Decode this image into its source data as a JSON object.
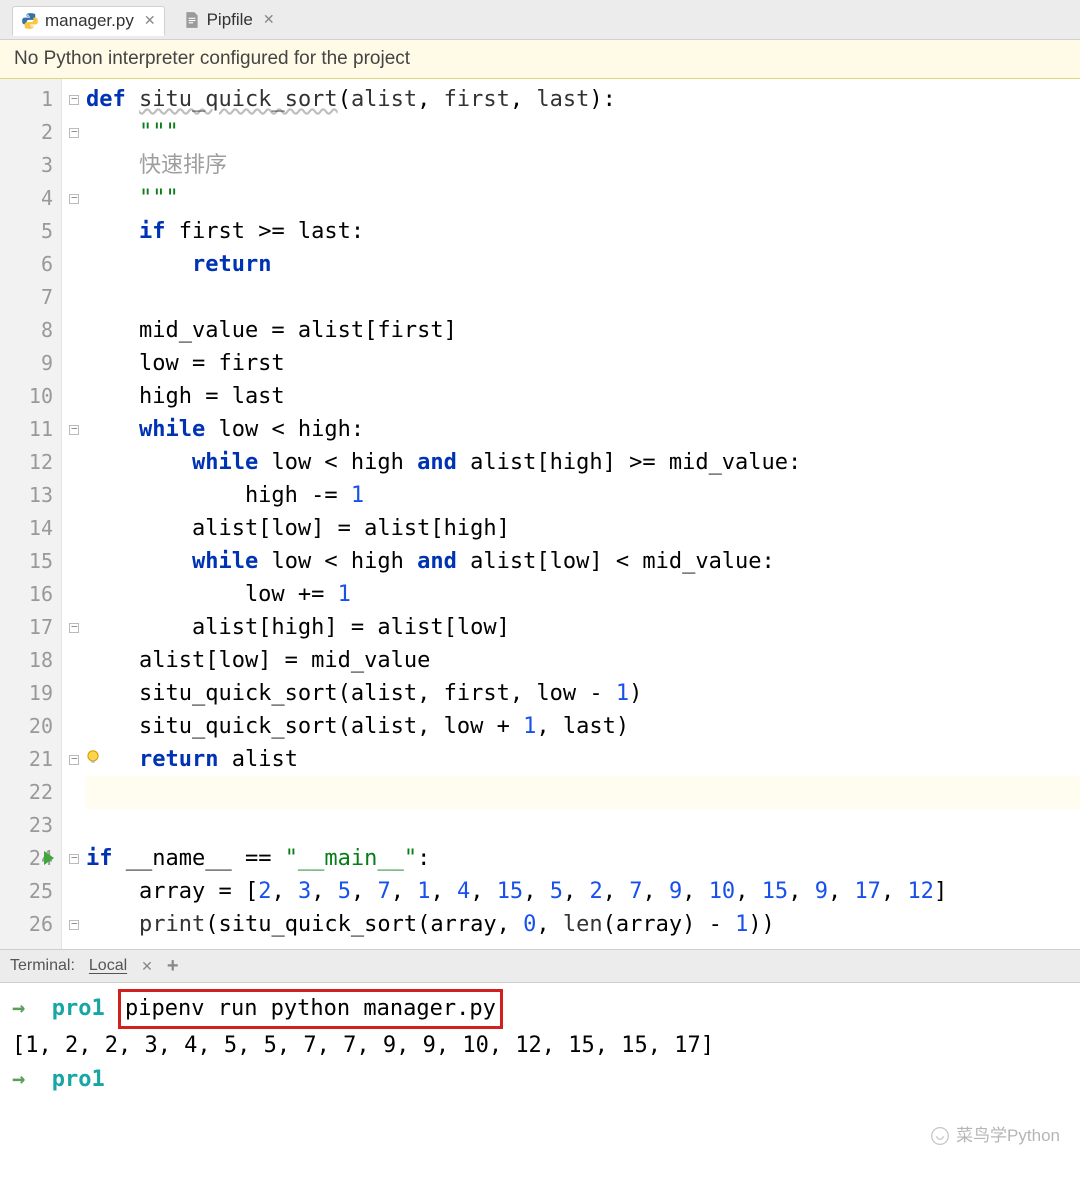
{
  "tabs": [
    {
      "label": "manager.py",
      "icon": "python-file-icon",
      "active": true
    },
    {
      "label": "Pipfile",
      "icon": "text-file-icon",
      "active": false
    }
  ],
  "warning": "No Python interpreter configured for the project",
  "code_lines": [
    {
      "n": 1,
      "fold": "start",
      "html": "<span class='kw'>def</span> <span class='fn wavy'>situ_quick_sort</span>(<span class='pv'>alist</span>, <span class='pv'>first</span>, <span class='pv'>last</span>):"
    },
    {
      "n": 2,
      "fold": "start",
      "html": "    <span class='str'>\"\"\"</span>"
    },
    {
      "n": 3,
      "html": "    <span class='com'>快速排序</span>"
    },
    {
      "n": 4,
      "fold": "end",
      "html": "    <span class='str'>\"\"\"</span>"
    },
    {
      "n": 5,
      "html": "    <span class='kw'>if</span> first &gt;= last:"
    },
    {
      "n": 6,
      "html": "        <span class='kw'>return</span>"
    },
    {
      "n": 7,
      "html": ""
    },
    {
      "n": 8,
      "html": "    mid_value = alist[first]"
    },
    {
      "n": 9,
      "html": "    low = first"
    },
    {
      "n": 10,
      "html": "    high = last"
    },
    {
      "n": 11,
      "fold": "start",
      "html": "    <span class='kw'>while</span> low &lt; high:"
    },
    {
      "n": 12,
      "html": "        <span class='kw'>while</span> low &lt; high <span class='kw'>and</span> alist[high] &gt;= mid_value:"
    },
    {
      "n": 13,
      "html": "            high -= <span class='num'>1</span>"
    },
    {
      "n": 14,
      "html": "        alist[low] = alist[high]"
    },
    {
      "n": 15,
      "html": "        <span class='kw'>while</span> low &lt; high <span class='kw'>and</span> alist[low] &lt; mid_value:"
    },
    {
      "n": 16,
      "html": "            low += <span class='num'>1</span>"
    },
    {
      "n": 17,
      "fold": "end",
      "html": "        alist[high] = alist[low]"
    },
    {
      "n": 18,
      "html": "    alist[low] = mid_value"
    },
    {
      "n": 19,
      "html": "    situ_quick_sort(alist, first, low - <span class='num'>1</span>)"
    },
    {
      "n": 20,
      "html": "    situ_quick_sort(alist, low + <span class='num'>1</span>, last)"
    },
    {
      "n": 21,
      "fold": "end",
      "bulb": true,
      "html": "    <span class='kw'>return</span> alist"
    },
    {
      "n": 22,
      "hl": true,
      "html": ""
    },
    {
      "n": 23,
      "html": ""
    },
    {
      "n": 24,
      "run": true,
      "fold": "start",
      "html": "<span class='kw'>if</span> __name__ == <span class='str'>\"__main__\"</span>:"
    },
    {
      "n": 25,
      "html": "    array = [<span class='num'>2</span>, <span class='num'>3</span>, <span class='num'>5</span>, <span class='num'>7</span>, <span class='num'>1</span>, <span class='num'>4</span>, <span class='num'>15</span>, <span class='num'>5</span>, <span class='num'>2</span>, <span class='num'>7</span>, <span class='num'>9</span>, <span class='num'>10</span>, <span class='num'>15</span>, <span class='num'>9</span>, <span class='num'>17</span>, <span class='num'>12</span>]"
    },
    {
      "n": 26,
      "fold": "end",
      "html": "    <span class='fn'>print</span>(situ_quick_sort(array, <span class='num'>0</span>, <span class='fn'>len</span>(array) - <span class='num'>1</span>))"
    }
  ],
  "terminal_panel": {
    "label": "Terminal:",
    "tab": "Local"
  },
  "terminal_lines": {
    "prompt_dir": "pro1",
    "command": "pipenv run python manager.py",
    "output": "[1, 2, 2, 3, 4, 5, 5, 7, 7, 9, 9, 10, 12, 15, 15, 17]",
    "prompt2_dir": "pro1"
  },
  "watermark": "菜鸟学Python"
}
